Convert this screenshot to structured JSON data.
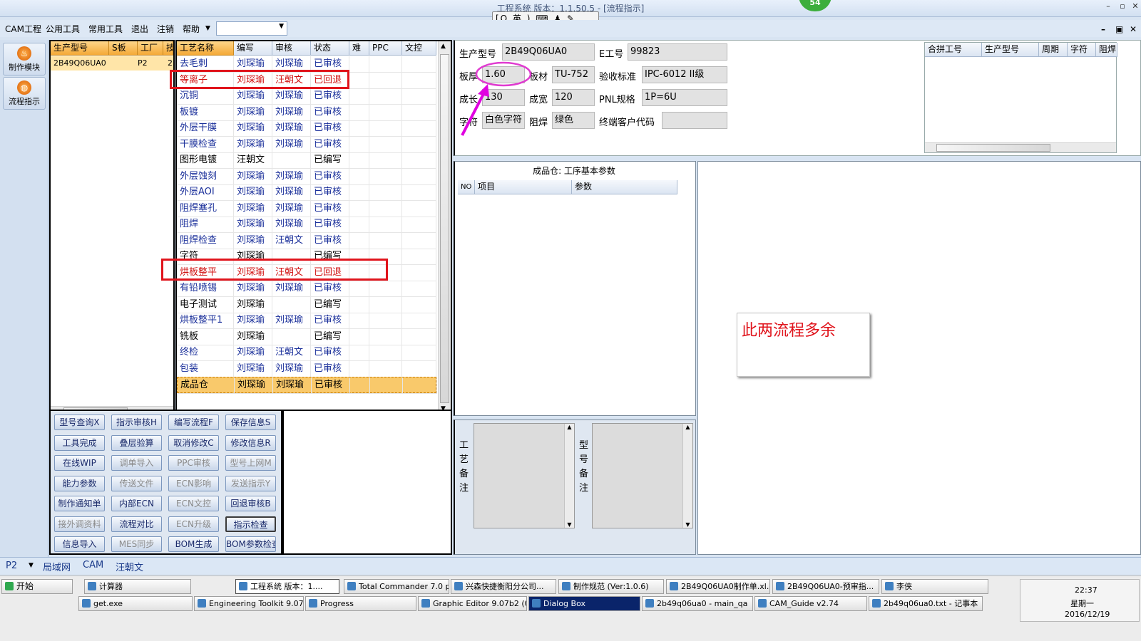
{
  "window": {
    "title": "工程系统   版本：1.1.50.5 - [流程指示]",
    "badge": "54",
    "ime": "[Q 英 ) ⌨ ♟ ✎"
  },
  "menubar": {
    "items": [
      "CAM工程",
      "公用工具",
      "常用工具",
      "退出",
      "注销",
      "帮助"
    ],
    "dropdown_value": ""
  },
  "left_toolbar": {
    "items": [
      {
        "label": "制作模块"
      },
      {
        "label": "流程指示"
      }
    ]
  },
  "jobs": {
    "columns": [
      "生产型号",
      "S板",
      "工厂",
      "技"
    ],
    "rows": [
      [
        "2B49Q06UA0",
        "",
        "P2",
        "2"
      ]
    ]
  },
  "process": {
    "columns": [
      "工艺名称",
      "编写",
      "审核",
      "状态",
      "难",
      "PPC",
      "文控"
    ],
    "rows": [
      {
        "name": "去毛刺",
        "writer": "刘琛瑜",
        "reviewer": "刘琛瑜",
        "status": "已审核",
        "style": "blue"
      },
      {
        "name": "等离子",
        "writer": "刘琛瑜",
        "reviewer": "汪朝文",
        "status": "已回退",
        "style": "red"
      },
      {
        "name": "沉铜",
        "writer": "刘琛瑜",
        "reviewer": "刘琛瑜",
        "status": "已审核",
        "style": "blue"
      },
      {
        "name": "板镀",
        "writer": "刘琛瑜",
        "reviewer": "刘琛瑜",
        "status": "已审核",
        "style": "blue"
      },
      {
        "name": "外层干膜",
        "writer": "刘琛瑜",
        "reviewer": "刘琛瑜",
        "status": "已审核",
        "style": "blue"
      },
      {
        "name": "干膜检查",
        "writer": "刘琛瑜",
        "reviewer": "刘琛瑜",
        "status": "已审核",
        "style": "blue"
      },
      {
        "name": "图形电镀",
        "writer": "汪朝文",
        "reviewer": "",
        "status": "已编写",
        "style": "black"
      },
      {
        "name": "外层蚀刻",
        "writer": "刘琛瑜",
        "reviewer": "刘琛瑜",
        "status": "已审核",
        "style": "blue"
      },
      {
        "name": "外层AOI",
        "writer": "刘琛瑜",
        "reviewer": "刘琛瑜",
        "status": "已审核",
        "style": "blue"
      },
      {
        "name": "阻焊塞孔",
        "writer": "刘琛瑜",
        "reviewer": "刘琛瑜",
        "status": "已审核",
        "style": "blue"
      },
      {
        "name": "阻焊",
        "writer": "刘琛瑜",
        "reviewer": "刘琛瑜",
        "status": "已审核",
        "style": "blue"
      },
      {
        "name": "阻焊检查",
        "writer": "刘琛瑜",
        "reviewer": "汪朝文",
        "status": "已审核",
        "style": "blue"
      },
      {
        "name": "字符",
        "writer": "刘琛瑜",
        "reviewer": "",
        "status": "已编写",
        "style": "black"
      },
      {
        "name": "烘板整平",
        "writer": "刘琛瑜",
        "reviewer": "汪朝文",
        "status": "已回退",
        "style": "red"
      },
      {
        "name": "有铅喷锡",
        "writer": "刘琛瑜",
        "reviewer": "刘琛瑜",
        "status": "已审核",
        "style": "blue"
      },
      {
        "name": "电子测试",
        "writer": "刘琛瑜",
        "reviewer": "",
        "status": "已编写",
        "style": "black"
      },
      {
        "name": "烘板整平1",
        "writer": "刘琛瑜",
        "reviewer": "刘琛瑜",
        "status": "已审核",
        "style": "blue"
      },
      {
        "name": "铣板",
        "writer": "刘琛瑜",
        "reviewer": "",
        "status": "已编写",
        "style": "black"
      },
      {
        "name": "终检",
        "writer": "刘琛瑜",
        "reviewer": "汪朝文",
        "status": "已审核",
        "style": "blue"
      },
      {
        "name": "包装",
        "writer": "刘琛瑜",
        "reviewer": "刘琛瑜",
        "status": "已审核",
        "style": "blue"
      },
      {
        "name": "成品仓",
        "writer": "刘琛瑜",
        "reviewer": "刘琛瑜",
        "status": "已审核",
        "style": "selected"
      }
    ]
  },
  "actions": {
    "buttons": [
      {
        "label": "型号查询X",
        "enabled": true
      },
      {
        "label": "指示审核H",
        "enabled": true
      },
      {
        "label": "编写流程F",
        "enabled": true
      },
      {
        "label": "保存信息S",
        "enabled": true
      },
      {
        "label": "工具完成",
        "enabled": true
      },
      {
        "label": "叠层验算",
        "enabled": true
      },
      {
        "label": "取消修改C",
        "enabled": true
      },
      {
        "label": "修改信息R",
        "enabled": true
      },
      {
        "label": "在线WIP",
        "enabled": true
      },
      {
        "label": "调单导入",
        "enabled": false
      },
      {
        "label": "PPC审核",
        "enabled": false
      },
      {
        "label": "型号上网M",
        "enabled": false
      },
      {
        "label": "能力参数",
        "enabled": true
      },
      {
        "label": "传送文件",
        "enabled": false
      },
      {
        "label": "ECN影响",
        "enabled": false
      },
      {
        "label": "发送指示Y",
        "enabled": false
      },
      {
        "label": "制作通知单",
        "enabled": true
      },
      {
        "label": "内部ECN",
        "enabled": true
      },
      {
        "label": "ECN文控",
        "enabled": false
      },
      {
        "label": "回退审核B",
        "enabled": true
      },
      {
        "label": "接外调资料",
        "enabled": false
      },
      {
        "label": "流程对比",
        "enabled": true
      },
      {
        "label": "ECN升级",
        "enabled": false
      },
      {
        "label": "指示检查",
        "enabled": true
      },
      {
        "label": "信息导入",
        "enabled": true
      },
      {
        "label": "MES同步",
        "enabled": false
      },
      {
        "label": "BOM生成",
        "enabled": true
      },
      {
        "label": "BOM参数检查",
        "enabled": true
      }
    ]
  },
  "info": {
    "prod_model_label": "生产型号",
    "prod_model": "2B49Q06UA0",
    "eno_label": "E工号",
    "eno": "99823",
    "thick_label": "板厚",
    "thick": "1.60",
    "material_label": "板材",
    "material": "TU-752",
    "accept_label": "验收标准",
    "accept": "IPC-6012 II级",
    "len_label": "成长",
    "len": "130",
    "width_label": "成宽",
    "width": "120",
    "pnl_label": "PNL规格",
    "pnl": "1P=6U",
    "char_label": "字符",
    "char": "白色字符",
    "mask_label": "阻焊",
    "mask": "绿色",
    "cust_label": "终端客户代码",
    "cust": ""
  },
  "merge_table": {
    "columns": [
      "合拼工号",
      "生产型号",
      "周期",
      "字符",
      "阻焊"
    ]
  },
  "params": {
    "title": "成品仓: 工序基本参数",
    "columns": [
      "NO",
      "项目",
      "参数"
    ]
  },
  "remarks": {
    "process_label": "工艺备注",
    "model_label": "型号备注"
  },
  "annotation": {
    "note": "此两流程多余",
    "color": "#e0141c"
  },
  "statusbar": {
    "plant": "P2",
    "items": [
      "局域网",
      "CAM",
      "汪朝文"
    ]
  },
  "taskbar": {
    "start": "开始",
    "row1": [
      "计算器",
      "工程系统  版本：1....",
      "Total Commander 7.0 p...",
      "兴森快捷衡阳分公司...",
      "制作规范 (Ver:1.0.6)",
      "2B49Q06UA0制作单.xl...",
      "2B49Q06UA0-预审指...",
      "李侠"
    ],
    "row2": [
      "get.exe",
      "Engineering Toolkit 9.07...",
      "Progress",
      "Graphic Editor 9.07b2 (0...",
      "Dialog Box",
      "2b49q06ua0 - main_qa",
      "CAM_Guide v2.74",
      "2b49q06ua0.txt - 记事本"
    ],
    "time": "22:37",
    "weekday": "星期一",
    "date": "2016/12/19"
  }
}
